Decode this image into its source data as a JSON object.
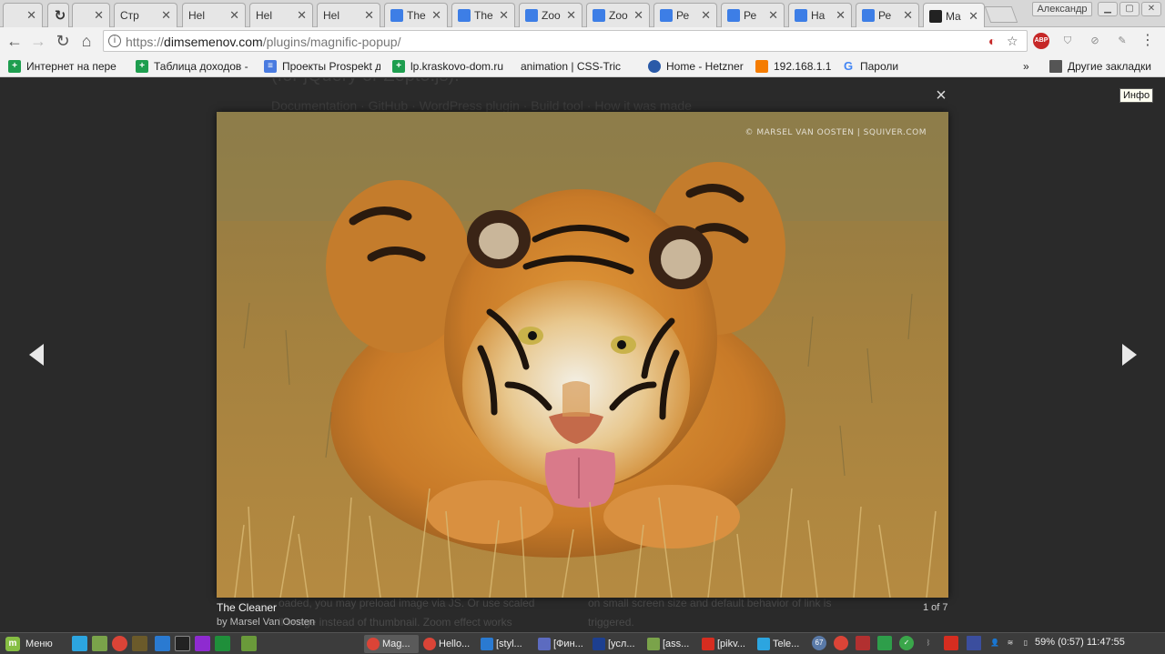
{
  "browser": {
    "tabs": [
      {
        "label": "",
        "icon": "page-icon"
      },
      {
        "label": "",
        "icon": "loading-icon"
      },
      {
        "label": "",
        "icon": "page-icon"
      },
      {
        "label": "Стр",
        "icon": "page-icon"
      },
      {
        "label": "Hel",
        "icon": "page-icon"
      },
      {
        "label": "Hel",
        "icon": "page-icon"
      },
      {
        "label": "Hel",
        "icon": "page-icon"
      },
      {
        "label": "The",
        "icon": "jsfiddle-icon"
      },
      {
        "label": "The",
        "icon": "jsfiddle-icon"
      },
      {
        "label": "Zoo",
        "icon": "jsfiddle-icon"
      },
      {
        "label": "Zoo",
        "icon": "jsfiddle-icon"
      },
      {
        "label": "Ре",
        "icon": "jsfiddle-icon"
      },
      {
        "label": "Ре",
        "icon": "jsfiddle-icon"
      },
      {
        "label": "Ha",
        "icon": "jsfiddle-icon"
      },
      {
        "label": "Ре",
        "icon": "jsfiddle-icon"
      },
      {
        "label": "Ma",
        "icon": "magnific-icon",
        "active": true
      }
    ],
    "profile_name": "Александр",
    "url_scheme": "https://",
    "url_host": "dimsemenov.com",
    "url_path": "/plugins/magnific-popup/",
    "bookmarks": [
      {
        "label": "Интернет на пере",
        "icon": "sheets-icon"
      },
      {
        "label": "Таблица доходов -",
        "icon": "sheets-icon"
      },
      {
        "label": "Проекты Prospekt д",
        "icon": "docs-icon"
      },
      {
        "label": "lp.kraskovo-dom.ru",
        "icon": "sheets-icon"
      },
      {
        "label": "animation | CSS-Tric",
        "icon": "page-icon"
      },
      {
        "label": "Home - Hetzner",
        "icon": "globe-icon"
      },
      {
        "label": "192.168.1.1",
        "icon": "router-icon"
      },
      {
        "label": "Пароли",
        "icon": "google-icon"
      }
    ],
    "bookmarks_overflow": "»",
    "other_bookmarks": "Другие закладки"
  },
  "page": {
    "bg_line1": "(for jQuery or Zepto.js).",
    "bg_line2": "Documentation · GitHub · WordPress plugin · Build tool · ",
    "bg_line2_link": "How it was made",
    "bg_left_1": "oaded, you may preload image via JS. Or use scaled",
    "bg_left_2": "ll image instead of thumbnail. Zoom effect works",
    "bg_right_1": "on small screen size and default behavior of link is",
    "bg_right_2": "triggered."
  },
  "lightbox": {
    "close_symbol": "×",
    "watermark": "© MARSEL VAN OOSTEN | SQUIVER.COM",
    "title": "The Cleaner",
    "author": "by Marsel Van Oosten",
    "counter": "1 of 7"
  },
  "tooltip": "Инфо",
  "taskbar": {
    "menu_label": "Меню",
    "tasks": [
      {
        "label": "Mag...",
        "color": "#db4437",
        "active": true
      },
      {
        "label": "Hello...",
        "color": "#db4437"
      },
      {
        "label": "[styl...",
        "color": "#2a7ad1"
      },
      {
        "label": "[Фин...",
        "color": "#5c6bc0"
      },
      {
        "label": "[усл...",
        "color": "#1d3f8f"
      },
      {
        "label": "[ass...",
        "color": "#7aa34a"
      },
      {
        "label": "[pikv...",
        "color": "#d62d20"
      },
      {
        "label": "Tele...",
        "color": "#2ca5e0"
      }
    ],
    "tray_badge": "67",
    "battery": "59% (0:57)",
    "time": "11:47:55"
  }
}
